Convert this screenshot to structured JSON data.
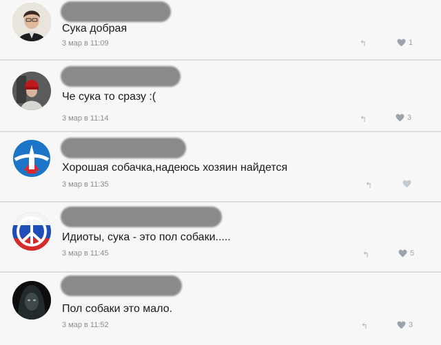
{
  "comments": [
    {
      "text": "Сука добрая",
      "date": "3 мар в 11:09",
      "likes": "1",
      "avatar_icon": "person-photo-icon"
    },
    {
      "text": "Че сука то сразу :(",
      "date": "3 мар в 11:14",
      "likes": "3",
      "avatar_icon": "red-hat-person-icon"
    },
    {
      "text": "Хорошая собачка,надеюсь хозяин найдется",
      "date": "3 мар в 11:35",
      "likes": "",
      "avatar_icon": "rocket-emblem-icon"
    },
    {
      "text": "Идиоты, сука - это пол собаки.....",
      "date": "3 мар в 11:45",
      "likes": "5",
      "avatar_icon": "peace-flag-icon"
    },
    {
      "text": "Пол собаки это мало.",
      "date": "3 мар в 11:52",
      "likes": "3",
      "avatar_icon": "hooded-figure-icon"
    }
  ],
  "colors": {
    "card": "#f7f7f7",
    "divider": "#dcdcdc",
    "meta": "#8d8d8d",
    "like": "#9ba3ad"
  }
}
